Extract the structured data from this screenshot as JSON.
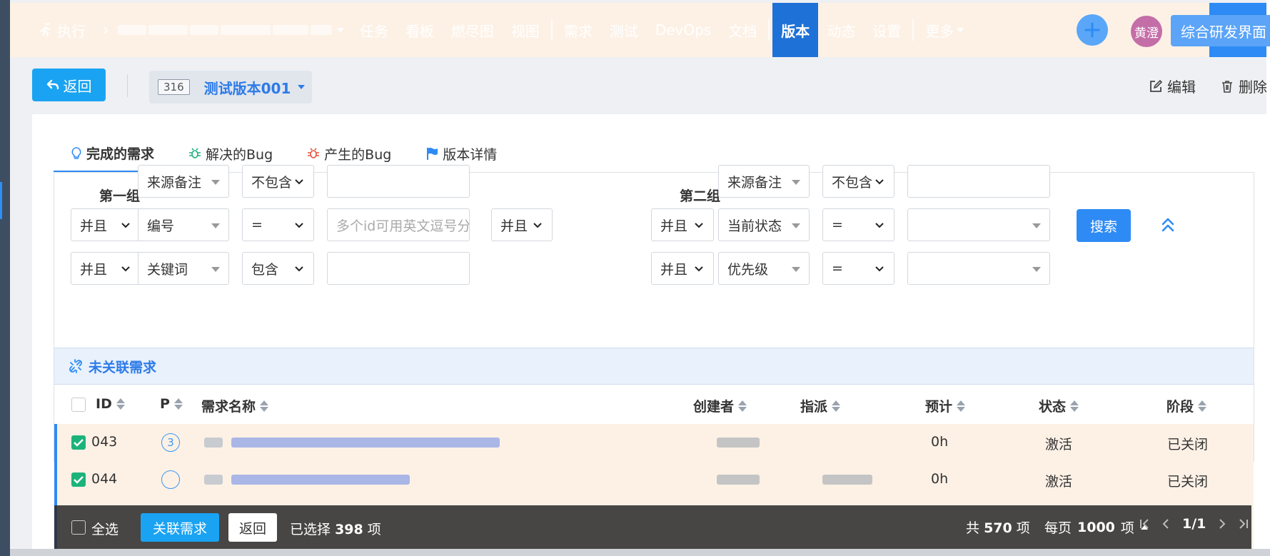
{
  "nav": {
    "exec": "执行",
    "items": [
      "任务",
      "看板",
      "燃尽图",
      "视图"
    ],
    "items2": [
      "需求",
      "测试",
      "DevOps",
      "文档"
    ],
    "items3": [
      "版本",
      "动态",
      "设置"
    ],
    "more": "更多",
    "avatar": "黄澄",
    "switch": "综合研发界面"
  },
  "subheader": {
    "back": "返回",
    "build_id": "316",
    "build_name": "测试版本001",
    "edit": "编辑",
    "delete": "删除"
  },
  "tabs": [
    "完成的需求",
    "解决的Bug",
    "产生的Bug",
    "版本详情"
  ],
  "filter": {
    "group1": "第一组",
    "group2": "第二组",
    "r1": {
      "field": "来源备注",
      "op": "不包含",
      "field2": "来源备注",
      "op2": "不包含"
    },
    "r2": {
      "and": "并且",
      "field": "编号",
      "op": "=",
      "placeholder": "多个id可用英文逗号分隔",
      "mid": "并且",
      "and2": "并且",
      "field2": "当前状态",
      "op2": "="
    },
    "r3": {
      "and": "并且",
      "field": "关键词",
      "op": "包含",
      "and2": "并且",
      "field2": "优先级",
      "op2": "="
    },
    "search": "搜索"
  },
  "unlinked_title": "未关联需求",
  "table": {
    "headers": {
      "id": "ID",
      "p": "P",
      "name": "需求名称",
      "creator": "创建者",
      "assign": "指派",
      "est": "预计",
      "status": "状态",
      "stage": "阶段"
    },
    "rows": [
      {
        "id": "043",
        "p": "3",
        "est": "0h",
        "status": "激活",
        "stage": "已关闭"
      },
      {
        "id": "044",
        "p": "",
        "est": "0h",
        "status": "激活",
        "stage": "已关闭"
      }
    ]
  },
  "actionbar": {
    "select_all": "全选",
    "link": "关联需求",
    "back": "返回",
    "selected_prefix": "已选择",
    "selected_count": "398",
    "selected_suffix": "项",
    "total_prefix": "共",
    "total": "570",
    "total_suffix": "项",
    "per_prefix": "每页",
    "per": "1000",
    "per_suffix": "项",
    "page": "1/1"
  },
  "colors": {
    "primary": "#2e8bf5",
    "accent": "#1aa3f3",
    "row_highlight": "#fdf1e6",
    "check": "#1cb37a"
  }
}
